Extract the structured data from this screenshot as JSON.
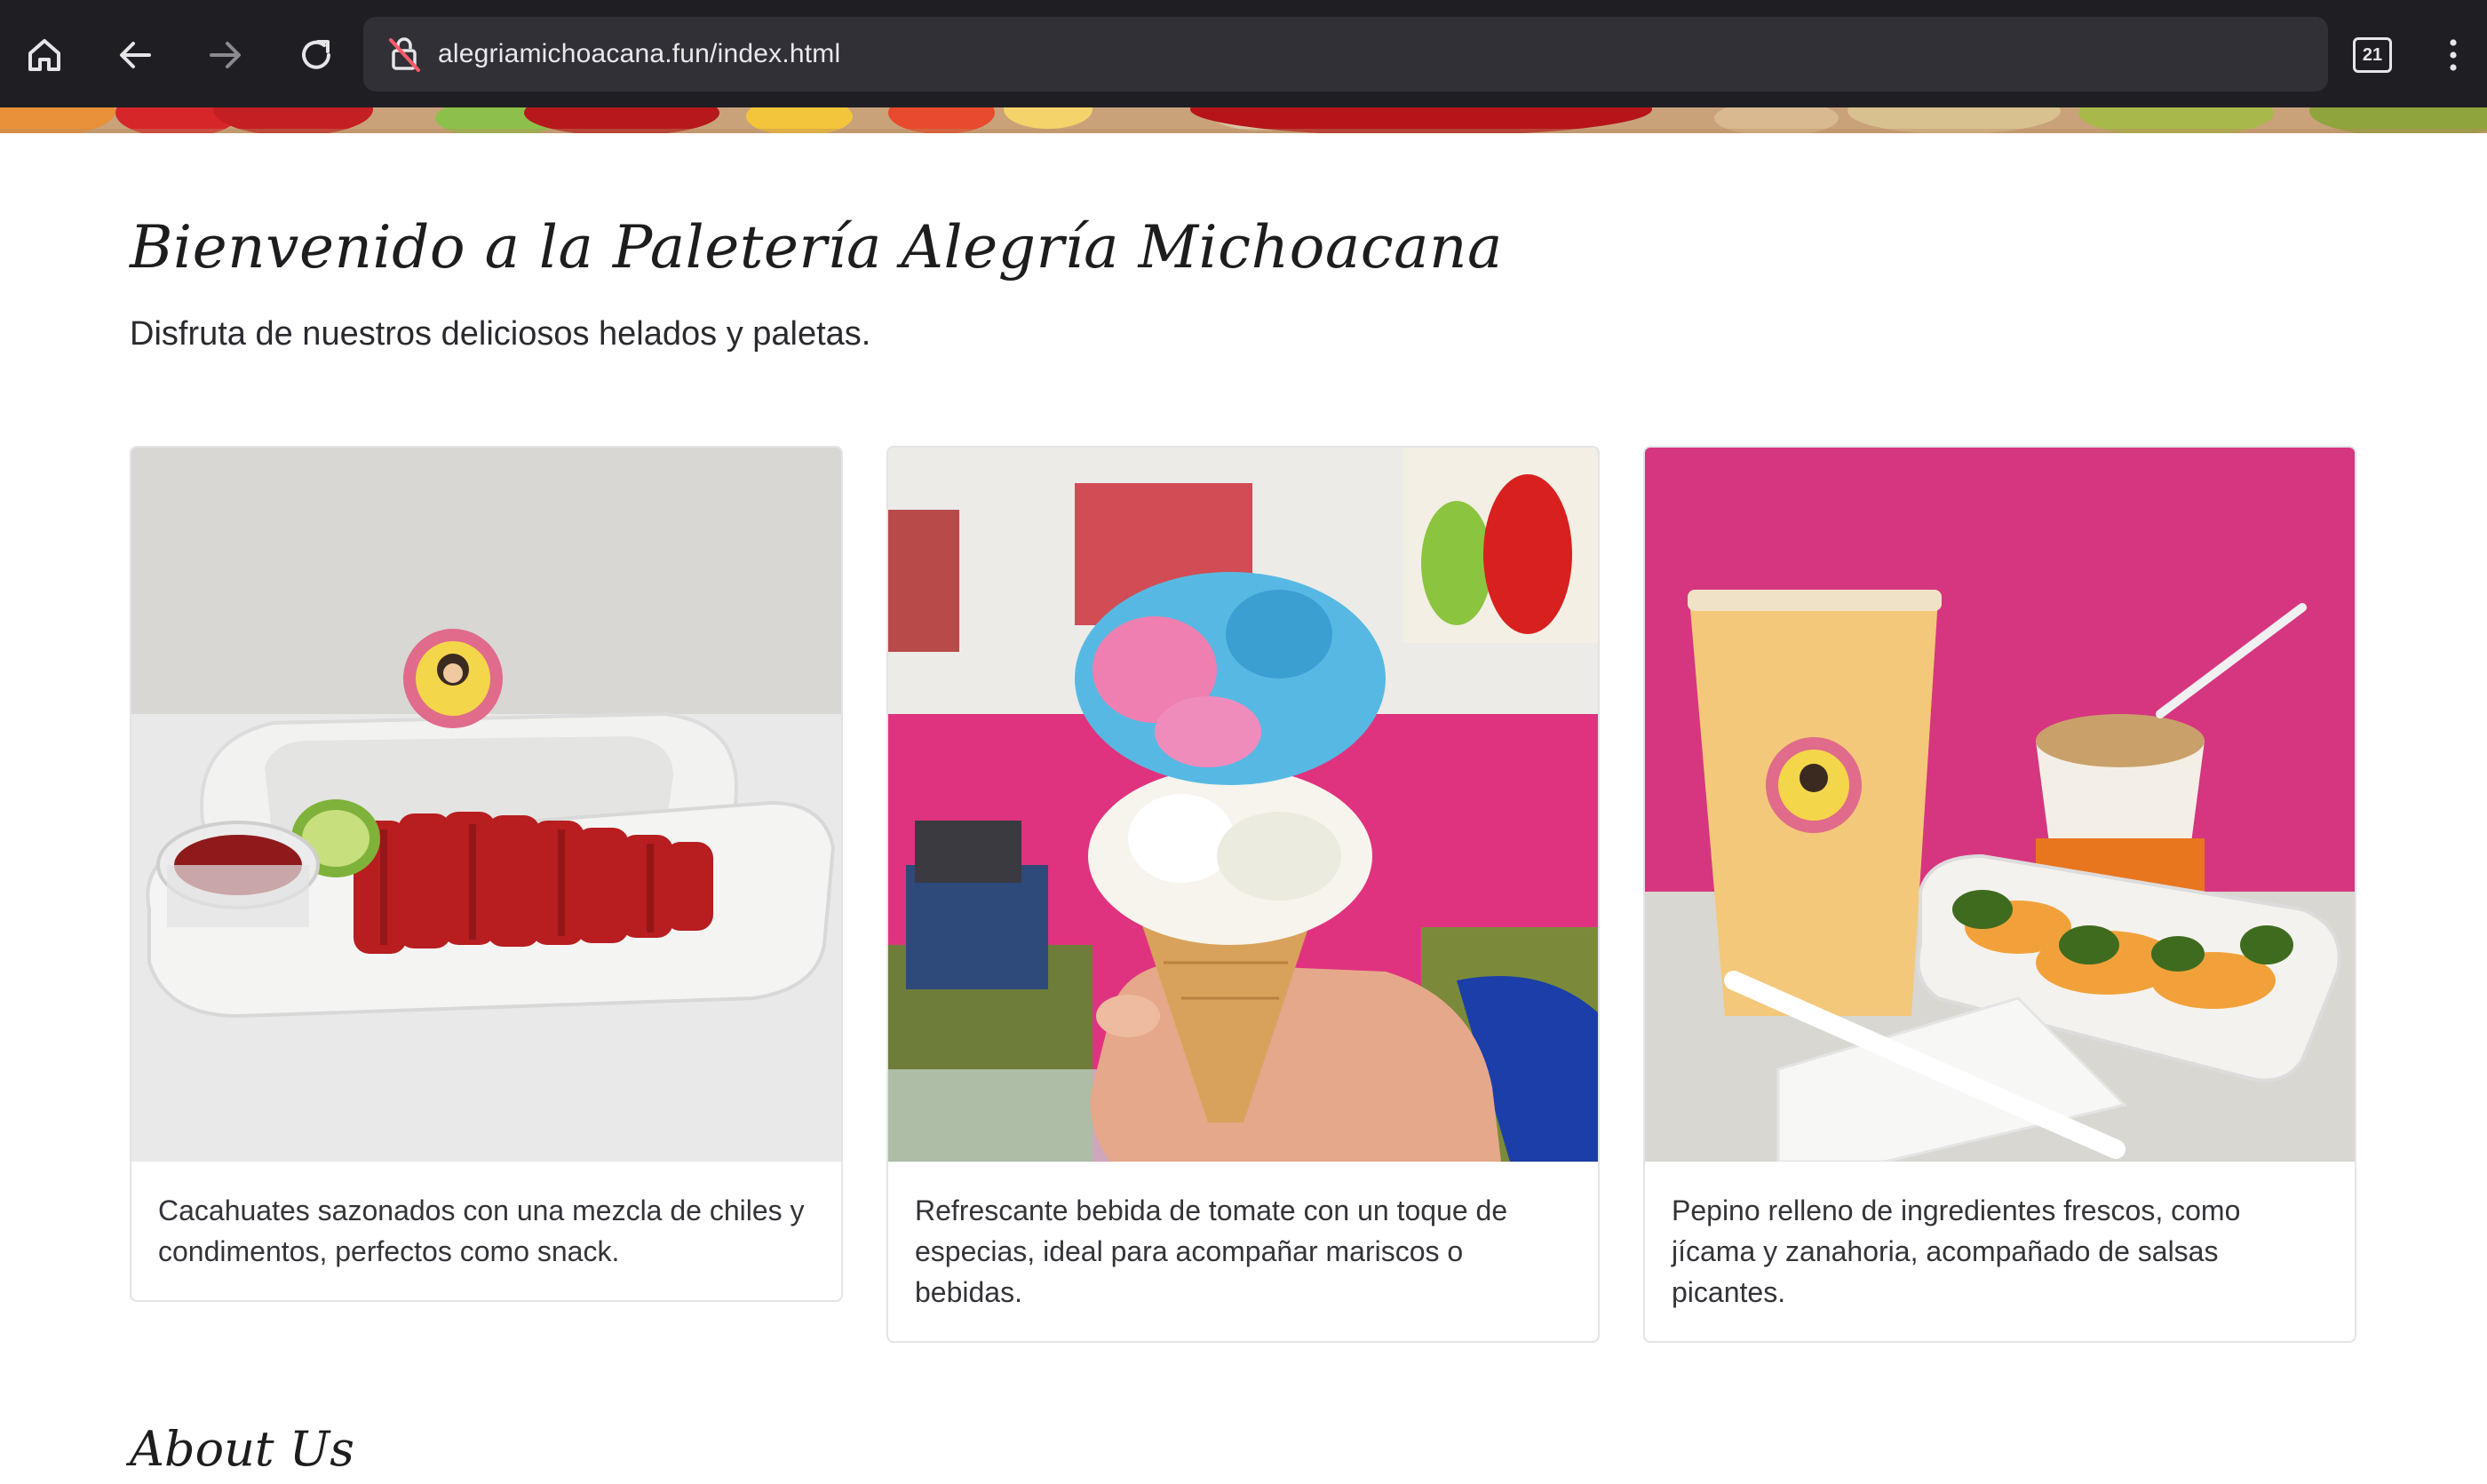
{
  "browser": {
    "url": "alegriamichoacana.fun/index.html",
    "tab_count": "21",
    "icons": [
      "home-icon",
      "back-arrow-icon",
      "forward-arrow-icon",
      "reload-icon",
      "not-secure-lock-icon",
      "tabs-icon",
      "kebab-menu-icon"
    ]
  },
  "page": {
    "title": "Bienvenido a la Paletería Alegría Michoacana",
    "subtitle": "Disfruta de nuestros deliciosos helados y paletas.",
    "cards": [
      {
        "caption": "Cacahuates sazonados con una mezcla de chiles y condimentos, perfectos como snack."
      },
      {
        "caption": "Refrescante bebida de tomate con un toque de especias, ideal para acompañar mariscos o bebidas."
      },
      {
        "caption": "Pepino relleno de ingredientes frescos, como jícama y zanahoria, acompañado de salsas picantes."
      }
    ],
    "section_heading": "About Us"
  },
  "colors": {
    "toolbar_bg": "#1f1f23",
    "urlbar_bg": "#303036",
    "pink_wall": "#e0337f",
    "text_dark": "#1d1d1f"
  }
}
